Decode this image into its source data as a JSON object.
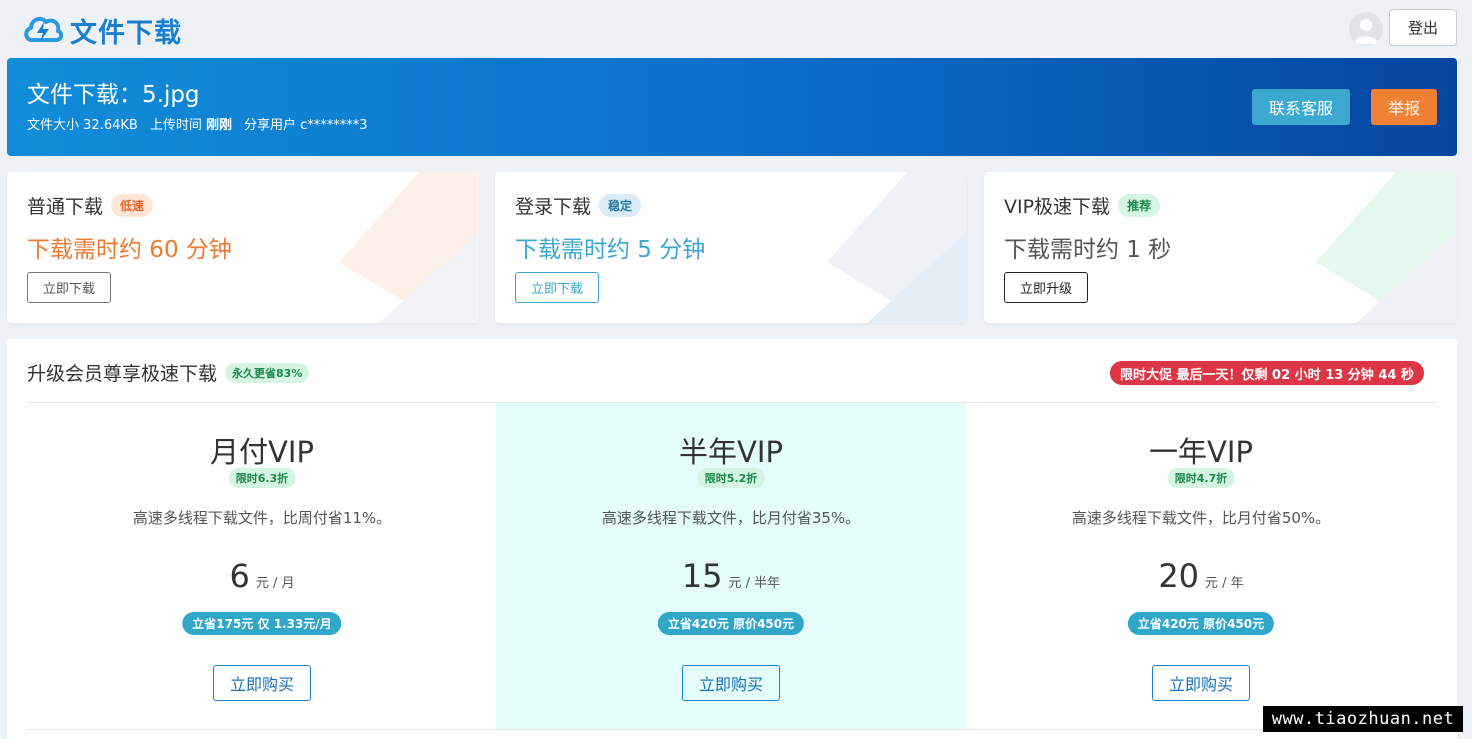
{
  "header": {
    "logo_text": "文件下载",
    "logo_icon": "cloud-lightning-icon",
    "avatar_icon": "user-avatar-icon",
    "logout_label": "登出"
  },
  "file": {
    "title": "文件下载：5.jpg",
    "size_label": "文件大小",
    "size_value": "32.64KB",
    "upload_label": "上传时间",
    "upload_value": "刚刚",
    "sharer_label": "分享用户",
    "sharer_value": "c********3",
    "contact_label": "联系客服",
    "report_label": "举报"
  },
  "download_options": [
    {
      "title": "普通下载",
      "tag": "低速",
      "time": "下载需时约 60 分钟",
      "button": "立即下载",
      "color": "#ee7a31"
    },
    {
      "title": "登录下载",
      "tag": "稳定",
      "time": "下载需时约 5 分钟",
      "button": "立即下载",
      "color": "#3aa8cf"
    },
    {
      "title": "VIP极速下载",
      "tag": "推荐",
      "time": "下载需时约 1 秒",
      "button": "立即升级",
      "color": "#555555"
    }
  ],
  "vip": {
    "title": "升级会员尊享极速下载",
    "tag": "永久更省83%",
    "promo": "限时大促 最后一天！仅剩 02 小时 13 分钟 44 秒",
    "plans": [
      {
        "name": "月付VIP",
        "badge": "限时6.3折",
        "desc": "高速多线程下载文件，比周付省11%。",
        "price": "6",
        "unit": "元 / 月",
        "save": "立省175元 仅 1.33元/月",
        "button": "立即购买"
      },
      {
        "name": "半年VIP",
        "badge": "限时5.2折",
        "desc": "高速多线程下载文件，比月付省35%。",
        "price": "15",
        "unit": "元 / 半年",
        "save": "立省420元 原价450元",
        "button": "立即购买"
      },
      {
        "name": "一年VIP",
        "badge": "限时4.7折",
        "desc": "高速多线程下载文件，比月付省50%。",
        "price": "20",
        "unit": "元 / 年",
        "save": "立省420元 原价450元",
        "button": "立即购买"
      }
    ]
  },
  "watermark": "www.tiaozhuan.net"
}
